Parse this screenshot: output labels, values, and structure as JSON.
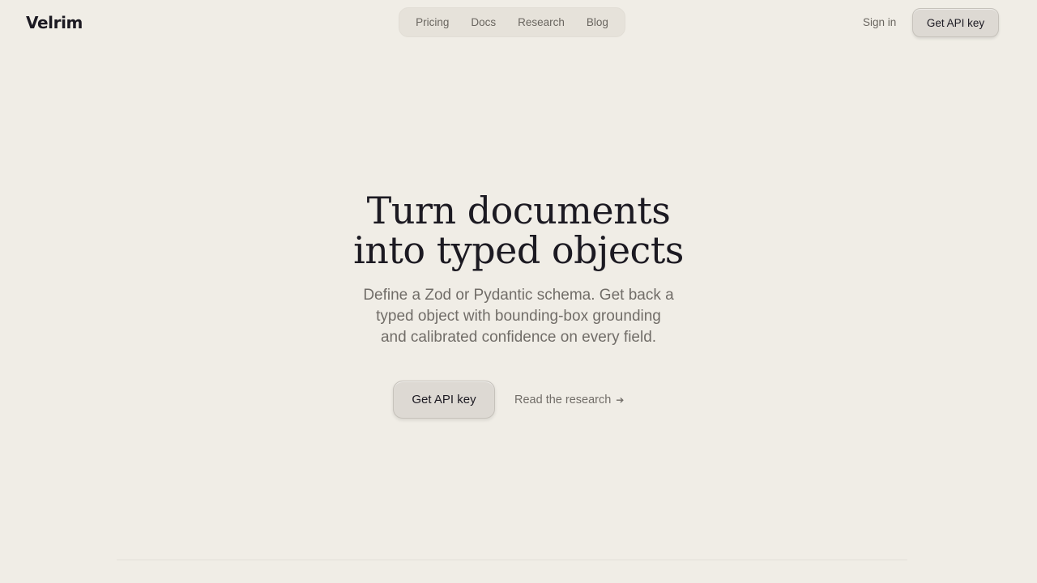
{
  "header": {
    "logo": "Velrim",
    "nav": [
      {
        "label": "Pricing"
      },
      {
        "label": "Docs"
      },
      {
        "label": "Research"
      },
      {
        "label": "Blog"
      }
    ],
    "sign_in": "Sign in",
    "cta": "Get API key"
  },
  "hero": {
    "title_lines": [
      "Turn documents",
      "into typed objects"
    ],
    "subtitle_lines": [
      "Define a Zod or Pydantic schema. Get back a",
      "typed object with bounding-box grounding",
      "and calibrated confidence on every field."
    ],
    "primary_cta": "Get API key",
    "secondary_cta": "Read the research",
    "secondary_icon": "arrow-right-icon"
  }
}
